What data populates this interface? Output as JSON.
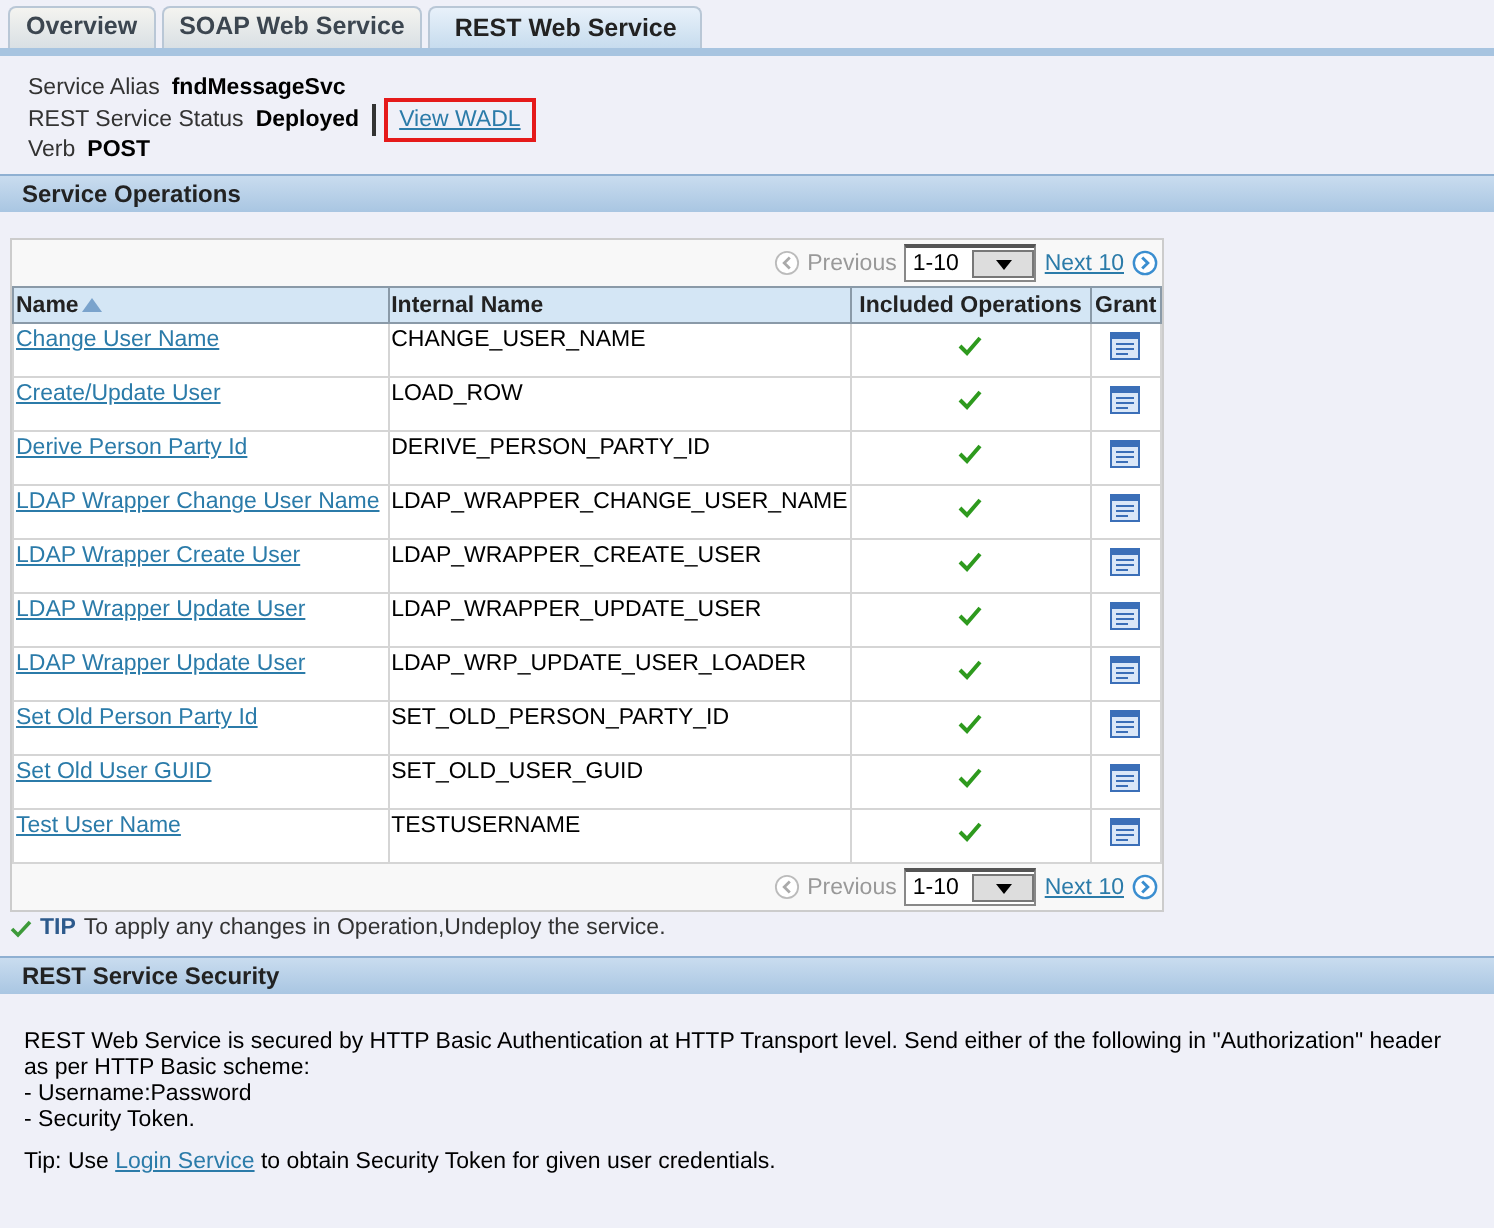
{
  "tabs": [
    {
      "label": "Overview",
      "selected": false
    },
    {
      "label": "SOAP Web Service",
      "selected": false
    },
    {
      "label": "REST Web Service",
      "selected": true
    }
  ],
  "service": {
    "alias_label": "Service Alias",
    "alias": "fndMessageSvc",
    "status_label": "REST Service Status",
    "status": "Deployed",
    "wadl_link": "View WADL",
    "verb_label": "Verb",
    "verb": "POST"
  },
  "operations": {
    "title": "Service Operations",
    "pager": {
      "previous": "Previous",
      "range": "1-10",
      "next": "Next 10"
    },
    "columns": [
      {
        "label": "Name",
        "sorted": true
      },
      {
        "label": "Internal Name",
        "sorted": false
      },
      {
        "label": "Included Operations",
        "sorted": false
      },
      {
        "label": "Grant",
        "sorted": false
      }
    ],
    "rows": [
      {
        "name": "Change User Name",
        "internal_name": "CHANGE_USER_NAME",
        "included": true
      },
      {
        "name": "Create/Update User",
        "internal_name": "LOAD_ROW",
        "included": true
      },
      {
        "name": "Derive Person Party Id",
        "internal_name": "DERIVE_PERSON_PARTY_ID",
        "included": true
      },
      {
        "name": "LDAP Wrapper Change User Name",
        "internal_name": "LDAP_WRAPPER_CHANGE_USER_NAME",
        "included": true
      },
      {
        "name": "LDAP Wrapper Create User",
        "internal_name": "LDAP_WRAPPER_CREATE_USER",
        "included": true
      },
      {
        "name": "LDAP Wrapper Update User",
        "internal_name": "LDAP_WRAPPER_UPDATE_USER",
        "included": true
      },
      {
        "name": "LDAP Wrapper Update User",
        "internal_name": "LDAP_WRP_UPDATE_USER_LOADER",
        "included": true
      },
      {
        "name": "Set Old Person Party Id",
        "internal_name": "SET_OLD_PERSON_PARTY_ID",
        "included": true
      },
      {
        "name": "Set Old User GUID",
        "internal_name": "SET_OLD_USER_GUID",
        "included": true
      },
      {
        "name": "Test User Name",
        "internal_name": "TESTUSERNAME",
        "included": true
      }
    ],
    "pager_bottom": {
      "previous": "Previous",
      "range": "1-10",
      "next": "Next 10"
    },
    "tip_label": "TIP",
    "tip": "To apply any changes in Operation,Undeploy the service."
  },
  "security": {
    "title": "REST Service Security",
    "text": "REST Web Service is secured by HTTP Basic Authentication at HTTP Transport level. Send either of the following in \"Authorization\" header as per HTTP Basic scheme:",
    "items": [
      "- Username:Password",
      "- Security Token."
    ],
    "tip_prefix": "Tip: Use",
    "tip_link": "Login Service",
    "tip_suffix": "to obtain Security Token for given user credentials."
  }
}
